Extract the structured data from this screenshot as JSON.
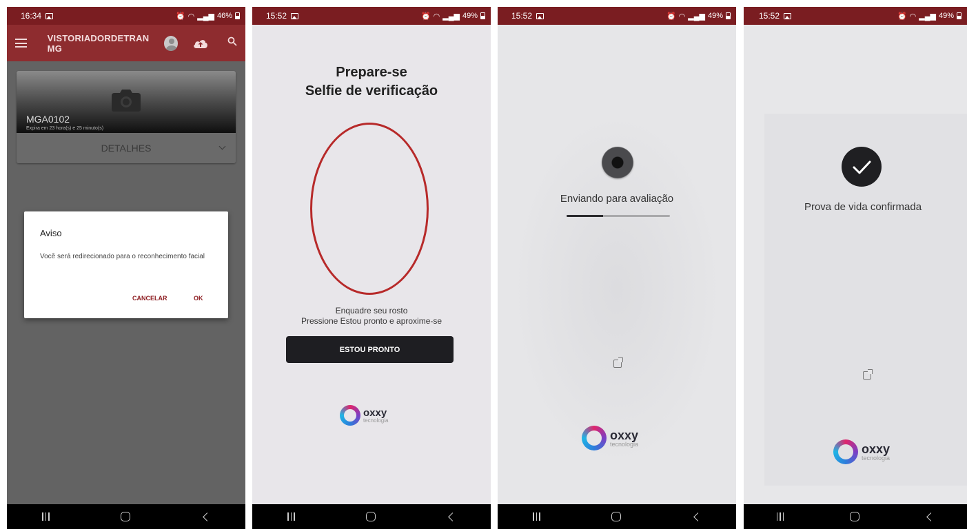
{
  "phones": [
    {
      "status": {
        "time": "16:34",
        "battery": "46%"
      },
      "appbar": {
        "title": "VISTORIADORDETRAN MG"
      },
      "card": {
        "plate": "MGA0102",
        "expires": "Expira em 23 hora(s) e 25 minuto(s)",
        "details_label": "DETALHES"
      },
      "dialog": {
        "title": "Aviso",
        "body": "Você será redirecionado para o reconhecimento facial",
        "cancel_label": "CANCELAR",
        "ok_label": "OK"
      }
    },
    {
      "status": {
        "time": "15:52",
        "battery": "49%"
      },
      "title_line1": "Prepare-se",
      "title_line2": "Selfie de verificação",
      "instruction_line1": "Enquadre seu rosto",
      "instruction_line2": "Pressione Estou pronto e aproxime-se",
      "button_label": "ESTOU PRONTO",
      "logo": {
        "name": "oxxy",
        "sub": "tecnologia"
      }
    },
    {
      "status": {
        "time": "15:52",
        "battery": "49%"
      },
      "message": "Enviando para avaliação",
      "progress": 0.35,
      "logo": {
        "name": "oxxy",
        "sub": "tecnologia"
      }
    },
    {
      "status": {
        "time": "15:52",
        "battery": "49%"
      },
      "message": "Prova de vida confirmada",
      "logo": {
        "name": "oxxy",
        "sub": "tecnologia"
      }
    }
  ],
  "colors": {
    "appbar": "#8e2c2f",
    "statusbar": "#7a1d21",
    "dialog_action": "#8e1e22",
    "oval": "#b72a2a",
    "button": "#1e1e22"
  },
  "icons": [
    "menu-icon",
    "avatar-icon",
    "cloud-upload-icon",
    "search-icon",
    "camera-icon",
    "chevron-down-icon",
    "external-link-icon",
    "checkmark-icon",
    "recents-icon",
    "home-icon",
    "back-icon"
  ]
}
